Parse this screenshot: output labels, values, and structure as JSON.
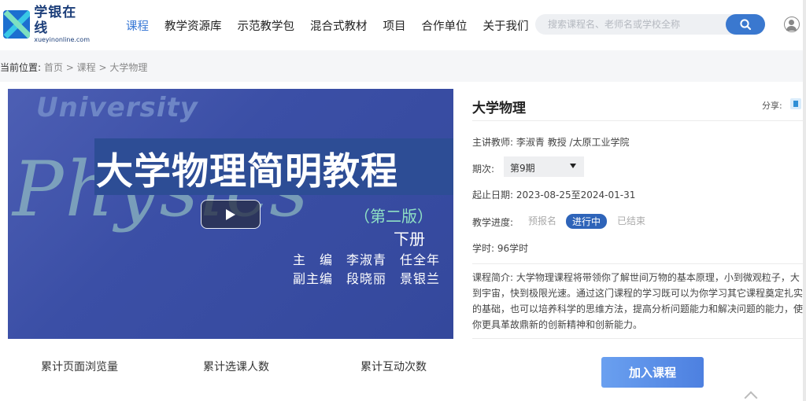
{
  "logo": {
    "title": "学银在线",
    "subtitle": "xueyinonline.com"
  },
  "nav": {
    "items": [
      "课程",
      "教学资源库",
      "示范教学包",
      "混合式教材",
      "项目",
      "合作单位",
      "关于我们"
    ],
    "active_index": 0
  },
  "search": {
    "placeholder": "搜索课程名、老师名或学校全称"
  },
  "breadcrumb": {
    "label": "当前位置:",
    "items": [
      "首页",
      "课程",
      "大学物理"
    ],
    "separator": ">"
  },
  "cover": {
    "university": "University",
    "physics": "Physics",
    "title": "大学物理简明教程",
    "edition": "（第二版）",
    "volume": "下册",
    "editor_line": "主　编　李淑青　任全年",
    "deputy_line": "副主编　段晓丽　景银兰"
  },
  "stats": {
    "views_label": "累计页面浏览量",
    "enrolled_label": "累计选课人数",
    "interactions_label": "累计互动次数"
  },
  "course": {
    "title": "大学物理",
    "share_label": "分享:",
    "teacher_label": "主讲教师:",
    "teacher": "李淑青 教授 /太原工业学院",
    "term_label": "期次:",
    "term_value": "第9期",
    "date_label": "起止日期:",
    "date_value": "2023-08-25至2024-01-31",
    "progress_label": "教学进度:",
    "progress_steps": [
      "预报名",
      "进行中",
      "已结束"
    ],
    "progress_active": "进行中",
    "hours_label": "学时:",
    "hours_value": "96学时",
    "intro_label": "课程简介:",
    "intro_text": "大学物理课程将带领你了解世间万物的基本原理，小到微观粒子，大到宇宙，快到极限光速。通过这门课程的学习既可以为你学习其它课程奠定扎实的基础，也可以培养科学的思维方法，提高分析问题能力和解决问题的能力，使你更具革故鼎新的创新精神和创新能力。",
    "join_label": "加入课程"
  },
  "colors": {
    "accent": "#3a78cf",
    "nav_active": "#3b7ad6",
    "progress_active": "#2e64b9"
  }
}
